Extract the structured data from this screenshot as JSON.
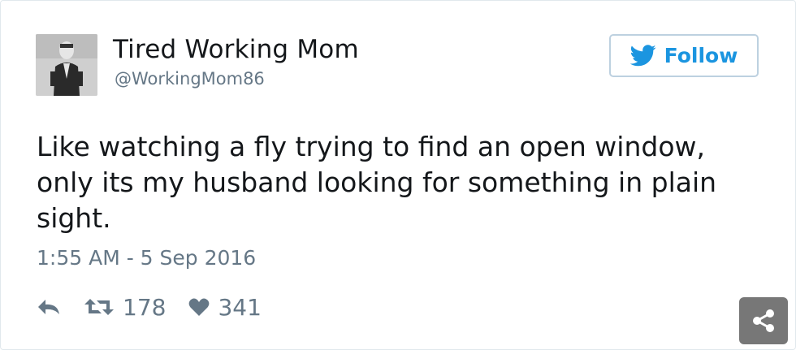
{
  "tweet": {
    "author_name": "Tired Working Mom",
    "handle": "@WorkingMom86",
    "follow_label": "Follow",
    "text_lines": [
      "Like watching a fly trying to find an open window,",
      "only its my husband looking for something in plain",
      "sight."
    ],
    "timestamp": "1:55 AM - 5 Sep 2016",
    "retweet_count": "178",
    "like_count": "341"
  },
  "icons": {
    "avatar": "profile-photo",
    "follow": "twitter-bird-icon",
    "reply": "reply-icon",
    "retweet": "retweet-icon",
    "like": "heart-icon",
    "share": "share-icon"
  },
  "colors": {
    "accent": "#1b95e0",
    "muted": "#657786",
    "text": "#14171a",
    "share_bg": "#777777"
  }
}
